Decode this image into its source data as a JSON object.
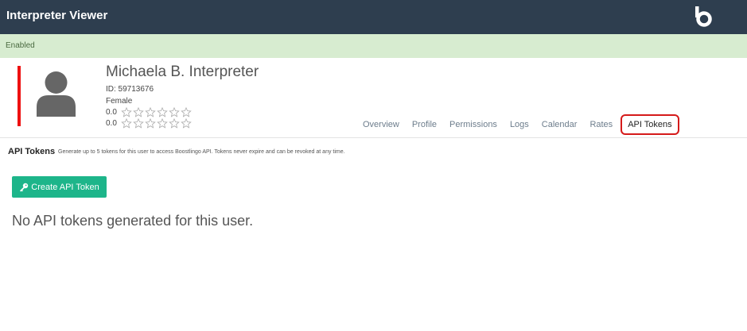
{
  "header": {
    "title": "Interpreter Viewer",
    "logo_icon": "boostlingo-logo-icon"
  },
  "status": {
    "text": "Enabled",
    "color": "#d7ecd0"
  },
  "user": {
    "name": "Michaela B. Interpreter",
    "id_line": "ID: 59713676",
    "gender": "Female",
    "ratings": [
      {
        "value": "0.0",
        "stars": 0,
        "max": 6
      },
      {
        "value": "0.0",
        "stars": 0,
        "max": 6
      }
    ],
    "accent_color": "#e11111"
  },
  "tabs": [
    {
      "label": "Overview",
      "active": false
    },
    {
      "label": "Profile",
      "active": false
    },
    {
      "label": "Permissions",
      "active": false
    },
    {
      "label": "Logs",
      "active": false
    },
    {
      "label": "Calendar",
      "active": false
    },
    {
      "label": "Rates",
      "active": false
    },
    {
      "label": "API Tokens",
      "active": true
    }
  ],
  "api_tokens": {
    "title": "API Tokens",
    "description": "Generate up to 5 tokens for this user to access Boostlingo API. Tokens never expire and can be revoked at any time.",
    "create_button": {
      "label": "Create API Token",
      "icon": "key-icon",
      "color": "#1db58a"
    },
    "empty_message": "No API tokens generated for this user."
  }
}
